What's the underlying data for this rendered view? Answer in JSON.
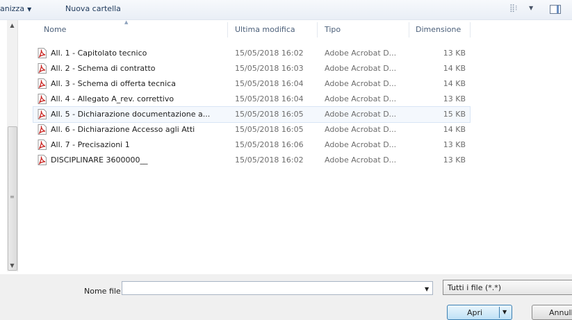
{
  "toolbar": {
    "organize_label": "anizza",
    "organize_arrow": "▼",
    "new_folder_label": "Nuova cartella",
    "view_icon": "view-options-icon",
    "view_arrow": "▼",
    "pane_icon": "preview-pane-icon"
  },
  "columns": {
    "name": "Nome",
    "date": "Ultima modifica",
    "type": "Tipo",
    "size": "Dimensione"
  },
  "files": [
    {
      "name": "All. 1 - Capitolato tecnico",
      "date": "15/05/2018 16:02",
      "type": "Adobe Acrobat D...",
      "size": "13 KB"
    },
    {
      "name": "All. 2 - Schema di contratto",
      "date": "15/05/2018 16:03",
      "type": "Adobe Acrobat D...",
      "size": "14 KB"
    },
    {
      "name": "All. 3 - Schema di offerta tecnica",
      "date": "15/05/2018 16:04",
      "type": "Adobe Acrobat D...",
      "size": "14 KB"
    },
    {
      "name": "All. 4 - Allegato A_rev. correttivo",
      "date": "15/05/2018 16:04",
      "type": "Adobe Acrobat D...",
      "size": "13 KB"
    },
    {
      "name": "All. 5 - Dichiarazione documentazione a...",
      "date": "15/05/2018 16:05",
      "type": "Adobe Acrobat D...",
      "size": "15 KB",
      "selected": true
    },
    {
      "name": "All. 6 - Dichiarazione Accesso agli Atti",
      "date": "15/05/2018 16:05",
      "type": "Adobe Acrobat D...",
      "size": "14 KB"
    },
    {
      "name": "All. 7 - Precisazioni 1",
      "date": "15/05/2018 16:06",
      "type": "Adobe Acrobat D...",
      "size": "13 KB"
    },
    {
      "name": "DISCIPLINARE 3600000__",
      "date": "15/05/2018 16:02",
      "type": "Adobe Acrobat D...",
      "size": "13 KB"
    }
  ],
  "file_icon": "pdf-icon",
  "footer": {
    "filename_label": "Nome file:",
    "filename_value": "",
    "filename_arrow": "▼",
    "filter_value": "Tutti i file (*.*)",
    "open_label": "Apri",
    "open_arrow": "▼",
    "cancel_label": "Annulla"
  },
  "scrollbar": {
    "up_arrow": "▲",
    "down_arrow": "▼",
    "grip": "≡"
  },
  "colors": {
    "pdf_red": "#c8201d",
    "selection_border": "#d8e5f5",
    "toolbar_text": "#1e395b"
  }
}
